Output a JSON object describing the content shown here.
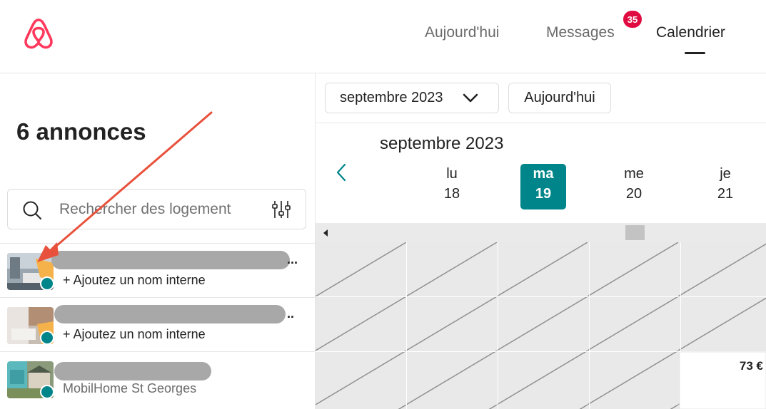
{
  "header": {
    "nav": {
      "today": "Aujourd'hui",
      "messages": "Messages",
      "calendar": "Calendrier"
    },
    "messages_badge": "35"
  },
  "sidebar": {
    "title": "6 annonces",
    "search_placeholder": "Rechercher des logement",
    "listings": [
      {
        "internal_name": "+ Ajoutez un nom interne",
        "thumb": "interior-photo"
      },
      {
        "internal_name": "+ Ajoutez un nom interne",
        "thumb": "bedroom-photo"
      },
      {
        "internal_name": "MobilHome St Georges",
        "thumb": "mobile-home-photo"
      }
    ]
  },
  "calendar": {
    "month_select": "septembre 2023",
    "today_button": "Aujourd'hui",
    "month_title": "septembre 2023",
    "days": [
      {
        "dow": "lu",
        "num": "18"
      },
      {
        "dow": "ma",
        "num": "19",
        "today": true
      },
      {
        "dow": "me",
        "num": "20"
      },
      {
        "dow": "je",
        "num": "21"
      }
    ],
    "price_cell": "73 €"
  },
  "colors": {
    "brand": "#ff385c",
    "teal": "#00858a",
    "badge": "#e00b41",
    "annotation_arrow": "#e8513b"
  }
}
